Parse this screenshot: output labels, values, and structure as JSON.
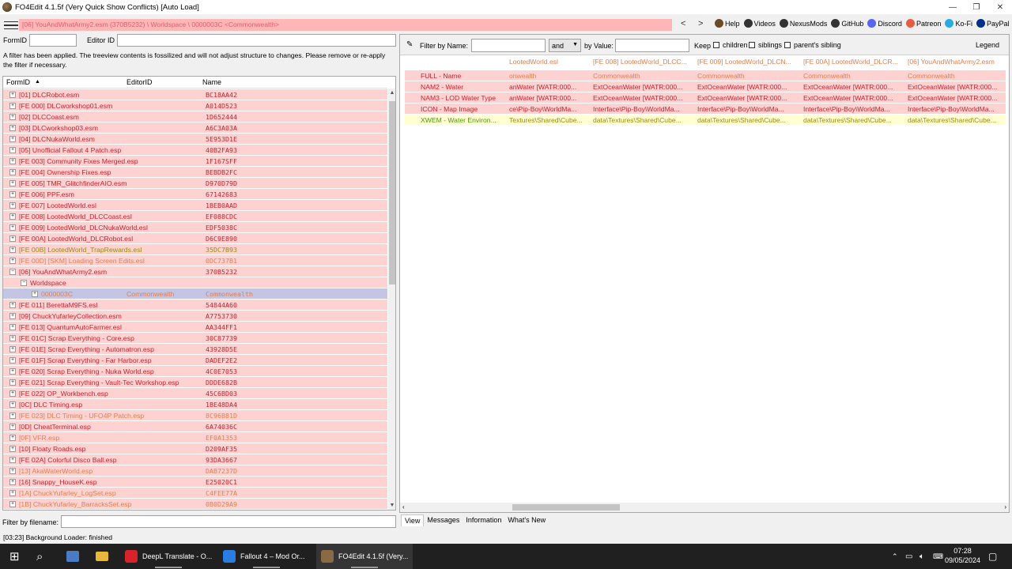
{
  "window": {
    "title": "FO4Edit 4.1.5f (Very Quick Show Conflicts) [Auto Load]",
    "controls": [
      "—",
      "❐",
      "✕"
    ]
  },
  "pathbar": {
    "path": "[06] YouAndWhatArmy2.esm (370B5232) \\ Worldspace \\ 0000003C <Commonwealth>",
    "back": "<",
    "forward": ">"
  },
  "toplinks": [
    {
      "label": "Help",
      "icon": "book-icon",
      "color": "#6b4a2a"
    },
    {
      "label": "Videos",
      "icon": "video-icon",
      "color": "#333333"
    },
    {
      "label": "NexusMods",
      "icon": "nexus-icon",
      "color": "#333333"
    },
    {
      "label": "GitHub",
      "icon": "github-icon",
      "color": "#333333"
    },
    {
      "label": "Discord",
      "icon": "discord-icon",
      "color": "#5865f2"
    },
    {
      "label": "Patreon",
      "icon": "patreon-icon",
      "color": "#e85b46"
    },
    {
      "label": "Ko-Fi",
      "icon": "kofi-icon",
      "color": "#29abe0"
    },
    {
      "label": "PayPal",
      "icon": "paypal-icon",
      "color": "#003087"
    }
  ],
  "left": {
    "formid_label": "FormID",
    "editorid_label": "Editor ID",
    "notice": "A filter has been applied. The treeview contents is fossilized and will not adjust structure to changes.  Please remove or re-apply the filter if necessary.",
    "columns": [
      "FormID",
      "EditorID",
      "Name"
    ],
    "filter_label": "Filter by filename:"
  },
  "tree": [
    {
      "name": "[01] DLCRobot.esm",
      "fid": "BC18AA42",
      "c": "red"
    },
    {
      "name": "[FE 000] DLCworkshop01.esm",
      "fid": "A014D523",
      "c": "red"
    },
    {
      "name": "[02] DLCCoast.esm",
      "fid": "1D652444",
      "c": "red"
    },
    {
      "name": "[03] DLCworkshop03.esm",
      "fid": "A6C3A03A",
      "c": "red"
    },
    {
      "name": "[04] DLCNukaWorld.esm",
      "fid": "5E953D1E",
      "c": "red"
    },
    {
      "name": "[05] Unofficial Fallout 4 Patch.esp",
      "fid": "40B2FA93",
      "c": "red"
    },
    {
      "name": "[FE 003] Community Fixes Merged.esp",
      "fid": "1F167SFF",
      "c": "red"
    },
    {
      "name": "[FE 004] Ownership Fixes.esp",
      "fid": "BEBDB2FC",
      "c": "red"
    },
    {
      "name": "[FE 005] TMR_GlitchfinderAIO.esm",
      "fid": "D970D79D",
      "c": "red"
    },
    {
      "name": "[FE 006] PPF.esm",
      "fid": "67142683",
      "c": "red"
    },
    {
      "name": "[FE 007] LootedWorld.esl",
      "fid": "1BEB0AAD",
      "c": "red"
    },
    {
      "name": "[FE 008] LootedWorld_DLCCoast.esl",
      "fid": "EF088CDC",
      "c": "red"
    },
    {
      "name": "[FE 009] LootedWorld_DLCNukaWorld.esl",
      "fid": "EDF5038C",
      "c": "red"
    },
    {
      "name": "[FE 00A] LootedWorld_DLCRobot.esl",
      "fid": "D6C9E890",
      "c": "red"
    },
    {
      "name": "[FE 00B] LootedWorld_TrapRewards.esl",
      "fid": "35DC7B93",
      "c": "olv"
    },
    {
      "name": "[FE 00D] [SKM] Loading Screen Edits.esl",
      "fid": "0DC737B1",
      "c": "org"
    },
    {
      "name": "[06] YouAndWhatArmy2.esm",
      "fid": "370B5232",
      "c": "red",
      "open": true
    },
    {
      "name": "Worldspace",
      "fid": "",
      "c": "red",
      "level": 1,
      "open": true
    },
    {
      "name": "0000003C",
      "eid": "Commonwealth",
      "fid": "Commonwealth",
      "c": "org",
      "level": 2,
      "selected": true
    },
    {
      "name": "[FE 011] BerettaM9FS.esl",
      "fid": "54844A60",
      "c": "red"
    },
    {
      "name": "[09] ChuckYufarleyCollection.esm",
      "fid": "A7753730",
      "c": "red"
    },
    {
      "name": "[FE 013] QuantumAutoFarmer.esl",
      "fid": "AA344FF1",
      "c": "red"
    },
    {
      "name": "[FE 01C] Scrap Everything - Core.esp",
      "fid": "30C87739",
      "c": "red"
    },
    {
      "name": "[FE 01E] Scrap Everything - Automatron.esp",
      "fid": "43928D5E",
      "c": "red"
    },
    {
      "name": "[FE 01F] Scrap Everything - Far Harbor.esp",
      "fid": "DADEF2E2",
      "c": "red"
    },
    {
      "name": "[FE 020] Scrap Everything - Nuka World.esp",
      "fid": "4C0E7053",
      "c": "red"
    },
    {
      "name": "[FE 021] Scrap Everything - Vault-Tec Workshop.esp",
      "fid": "DDDE682B",
      "c": "red"
    },
    {
      "name": "[FE 022] OP_Workbench.esp",
      "fid": "45C6BD03",
      "c": "red"
    },
    {
      "name": "[0C] DLC Timing.esp",
      "fid": "1BE48DA4",
      "c": "red"
    },
    {
      "name": "[FE 023] DLC Timing - UFO4P Patch.esp",
      "fid": "8C96B81D",
      "c": "org"
    },
    {
      "name": "[0D] CheatTerminal.esp",
      "fid": "6A74036C",
      "c": "red"
    },
    {
      "name": "[0F] VFR.esp",
      "fid": "EF0A1353",
      "c": "org"
    },
    {
      "name": "[10] Floaty Roads.esp",
      "fid": "D209AF35",
      "c": "red"
    },
    {
      "name": "[FE 02A] Colorful Disco Ball.esp",
      "fid": "93DA3667",
      "c": "red"
    },
    {
      "name": "[13] AkaWaterWorld.esp",
      "fid": "DAB7237D",
      "c": "org"
    },
    {
      "name": "[16] Snappy_HouseK.esp",
      "fid": "E25020C1",
      "c": "red"
    },
    {
      "name": "[1A] ChuckYufarley_LogSet.esp",
      "fid": "C4FEE77A",
      "c": "org"
    },
    {
      "name": "[1B] ChuckYufarley_BarracksSet.esp",
      "fid": "0B0D29A9",
      "c": "org"
    }
  ],
  "filter": {
    "by_name_label": "Filter by Name:",
    "op_value": "and",
    "by_value_label": "by Value:",
    "keep_label": "Keep",
    "checks": [
      "children",
      "siblings",
      "parent's sibling"
    ],
    "legend": "Legend"
  },
  "grid": {
    "headers": [
      "LootedWorld.esl",
      "[FE 008] LootedWorld_DLCC...",
      "[FE 009] LootedWorld_DLCN...",
      "[FE 00A] LootedWorld_DLCR...",
      "[06] YouAndWhatArmy2.esm"
    ],
    "rows": [
      {
        "label": "FULL - Name",
        "c": "red",
        "bg": "pink",
        "vals": [
          "onwealth",
          "Commonwealth",
          "Commonwealth",
          "Commonwealth",
          "Commonwealth"
        ],
        "vc": "org"
      },
      {
        "label": "NAM2 - Water",
        "c": "red",
        "bg": "pink",
        "vals": [
          "anWater [WATR:000...",
          "ExtOceanWater [WATR:000...",
          "ExtOceanWater [WATR:000...",
          "ExtOceanWater [WATR:000...",
          "ExtOceanWater [WATR:000..."
        ],
        "vc": "red"
      },
      {
        "label": "NAM3 - LOD Water Type",
        "c": "red",
        "bg": "pink",
        "vals": [
          "anWater [WATR:000...",
          "ExtOceanWater [WATR:000...",
          "ExtOceanWater [WATR:000...",
          "ExtOceanWater [WATR:000...",
          "ExtOceanWater [WATR:000..."
        ],
        "vc": "red"
      },
      {
        "label": "ICON - Map Image",
        "c": "red",
        "bg": "pink",
        "vals": [
          "ce\\Pip-Boy\\WorldMa...",
          "Interface\\Pip-Boy\\WorldMa...",
          "Interface\\Pip-Boy\\WorldMa...",
          "Interface\\Pip-Boy\\WorldMa...",
          "Interface\\Pip-Boy\\WorldMa..."
        ],
        "vc": "red"
      },
      {
        "label": "XWEM - Water Environ...",
        "c": "grn",
        "bg": "yel",
        "vals": [
          "Textures\\Shared\\Cube...",
          "data\\Textures\\Shared\\Cube...",
          "data\\Textures\\Shared\\Cube...",
          "data\\Textures\\Shared\\Cube...",
          "data\\Textures\\Shared\\Cube..."
        ],
        "vc": "olv"
      }
    ]
  },
  "tabs": [
    "View",
    "Messages",
    "Information",
    "What's New"
  ],
  "status": "[03:23] Background Loader: finished",
  "taskbar": {
    "apps": [
      {
        "label": "DeepL Translate - O...",
        "icon": "vivaldi-icon",
        "color": "#d8232a"
      },
      {
        "label": "Fallout 4 – Mod Or...",
        "icon": "folder-icon",
        "color": "#2a7de1"
      },
      {
        "label": "FO4Edit 4.1.5f (Very...",
        "icon": "fo4edit-icon",
        "color": "#8a6a45",
        "active": true
      }
    ],
    "time": "07:28",
    "date": "09/05/2024"
  }
}
